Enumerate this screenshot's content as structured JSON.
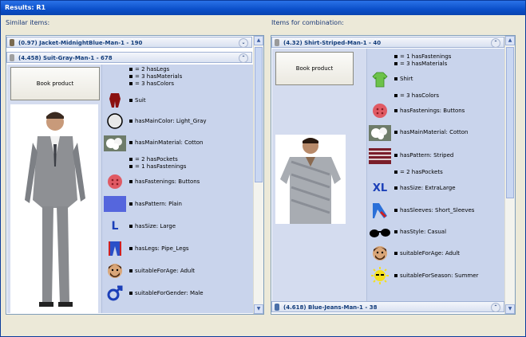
{
  "window": {
    "title": "Results: R1"
  },
  "labels": {
    "similar": "Similar items:",
    "combination": "Items for combination:"
  },
  "left": {
    "header1": "(0.97) Jacket-MidnightBlue-Man-1 - 190",
    "header2": "(4.458) Suit-Gray-Man-1 - 678",
    "book": "Book product",
    "attrs": [
      "= 2 hasLegs",
      "= 3 hasMaterials",
      "= 3 hasColors",
      "Suit",
      "hasMainColor: Light_Gray",
      "hasMainMaterial: Cotton",
      "= 2 hasPockets",
      "= 1 hasFastenings",
      "hasFastenings: Buttons",
      "hasPattern: Plain",
      "hasSize: Large",
      "hasLegs: Pipe_Legs",
      "suitableForAge: Adult",
      "suitableForGender: Male"
    ]
  },
  "right": {
    "header1": "(4.32) Shirt-Striped-Man-1 - 40",
    "header2": "(4.618) Blue-Jeans-Man-1 - 38",
    "book": "Book product",
    "attrs": [
      "= 1 hasFastenings",
      "= 3 hasMaterials",
      "Shirt",
      "= 3 hasColors",
      "hasFastenings: Buttons",
      "hasMainMaterial: Cotton",
      "hasPattern: Striped",
      "= 2 hasPockets",
      "hasSize: ExtraLarge",
      "hasSleeves: Short_Sleeves",
      "hasStyle: Casual",
      "suitableForAge: Adult",
      "suitableForSeason: Summer"
    ]
  },
  "icons": {
    "size_large": "L",
    "size_xl": "XL"
  }
}
